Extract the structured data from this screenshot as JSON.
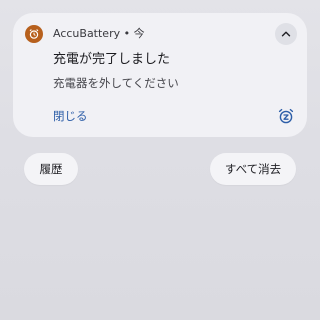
{
  "notification": {
    "app_name": "AccuBattery",
    "separator": "•",
    "time": "今",
    "header": "AccuBattery • 今",
    "title": "充電が完了しました",
    "body": "充電器を外してください",
    "action_label": "閉じる",
    "app_icon": "alarm-clock-icon",
    "expand_icon": "chevron-up-icon",
    "snooze_icon": "snooze-alarm-icon",
    "accent_color": "#b7601d",
    "action_color": "#2d5ea8"
  },
  "footer": {
    "history_label": "履歴",
    "clear_all_label": "すべて消去"
  }
}
